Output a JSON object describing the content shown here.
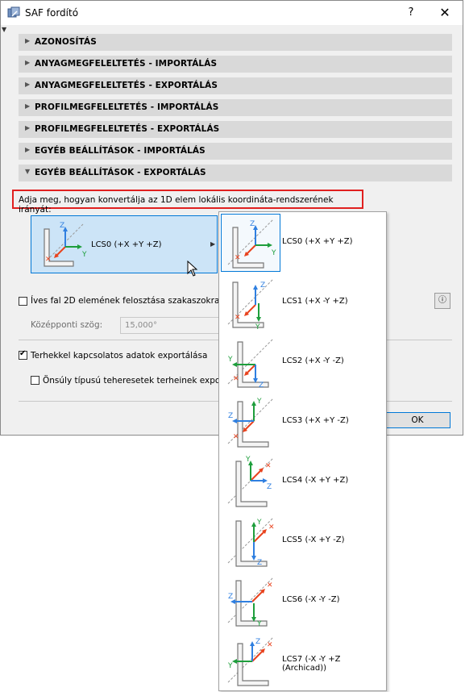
{
  "window": {
    "title": "SAF fordító",
    "help_label": "?",
    "close_label": "✕"
  },
  "sections": [
    {
      "label": "AZONOSÍTÁS",
      "expanded": false
    },
    {
      "label": "ANYAGMEGFELELTETÉS - IMPORTÁLÁS",
      "expanded": false
    },
    {
      "label": "ANYAGMEGFELELTETÉS - EXPORTÁLÁS",
      "expanded": false
    },
    {
      "label": "PROFILMEGFELELTETÉS - IMPORTÁLÁS",
      "expanded": false
    },
    {
      "label": "PROFILMEGFELELTETÉS - EXPORTÁLÁS",
      "expanded": false
    },
    {
      "label": "EGYÉB BEÁLLÍTÁSOK - IMPORTÁLÁS",
      "expanded": false
    },
    {
      "label": "EGYÉB BEÁLLÍTÁSOK - EXPORTÁLÁS",
      "expanded": true
    }
  ],
  "export_settings": {
    "prompt": "Adja meg, hogyan konvertálja az 1D elem lokális koordináta-rendszerének irányát:",
    "selected_lcs": "LCS0 (+X +Y +Z)",
    "curved_wall_label": "Íves fal 2D elemének felosztása szakaszokra",
    "curved_wall_checked": false,
    "central_angle_label": "Középponti szög:",
    "central_angle_value": "15,000°",
    "info_label": "ⓘ",
    "load_export_label": "Terhekkel kapcsolatos adatok exportálása",
    "load_export_checked": true,
    "selfweight_label": "Önsúly típusú teheresetek terheinek expor",
    "selfweight_checked": false
  },
  "buttons": {
    "ok": "OK"
  },
  "dropdown": {
    "items": [
      {
        "label": "LCS0 (+X +Y +Z)",
        "selected": true
      },
      {
        "label": "LCS1 (+X -Y +Z)",
        "selected": false
      },
      {
        "label": "LCS2 (+X -Y -Z)",
        "selected": false
      },
      {
        "label": "LCS3 (+X +Y -Z)",
        "selected": false
      },
      {
        "label": "LCS4 (-X +Y +Z)",
        "selected": false
      },
      {
        "label": "LCS5 (-X +Y -Z)",
        "selected": false
      },
      {
        "label": "LCS6 (-X -Y -Z)",
        "selected": false
      },
      {
        "label": "LCS7 (-X -Y +Z (Archicad))",
        "selected": false
      }
    ]
  },
  "axis_labels": {
    "x": "X",
    "y": "Y",
    "z": "Z"
  },
  "colors": {
    "x_axis": "#e8431e",
    "y_axis": "#1e9e3c",
    "z_axis": "#2f7fe0",
    "selection_bg": "#cce4f7",
    "selection_border": "#0078d7",
    "highlight_border": "#e0201f",
    "section_bg": "#d9d9d9"
  }
}
